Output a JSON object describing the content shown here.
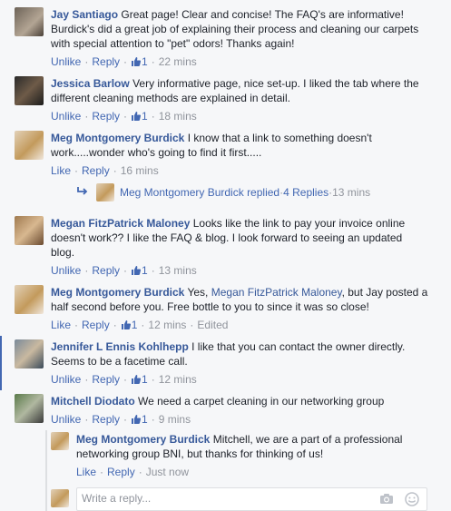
{
  "comments": [
    {
      "name": "Jay Santiago",
      "text": "Great page! Clear and concise! The FAQ's are informative! Burdick's did a great job of explaining their process and cleaning our carpets with special attention to \"pet\" odors! Thanks again!",
      "actions": {
        "like": "Unlike",
        "reply": "Reply",
        "likes": "1",
        "time": "22 mins"
      }
    },
    {
      "name": "Jessica Barlow",
      "text": "Very informative page, nice set-up. I liked the tab where the different cleaning methods are explained in detail.",
      "actions": {
        "like": "Unlike",
        "reply": "Reply",
        "likes": "1",
        "time": "18 mins"
      }
    },
    {
      "name": "Meg Montgomery Burdick",
      "text": "I know that a link to something doesn't work.....wonder who's going to find it first.....",
      "actions": {
        "like": "Like",
        "reply": "Reply",
        "time": "16 mins"
      },
      "replies_summary": {
        "name": "Meg Montgomery Burdick",
        "replied": "replied",
        "count": "4 Replies",
        "time": "13 mins"
      }
    },
    {
      "name": "Megan FitzPatrick Maloney",
      "text": "Looks like the link to pay your invoice online doesn't work?? I like the FAQ & blog. I look forward to seeing an updated blog.",
      "actions": {
        "like": "Unlike",
        "reply": "Reply",
        "likes": "1",
        "time": "13 mins"
      }
    },
    {
      "name": "Meg Montgomery Burdick",
      "text_before": "Yes,",
      "mention": "Megan FitzPatrick Maloney",
      "text_after": ", but Jay posted a half second before you. Free bottle to you to since it was so close!",
      "actions": {
        "like": "Like",
        "reply": "Reply",
        "likes": "1",
        "time": "12 mins",
        "edited": "Edited"
      }
    },
    {
      "name": "Jennifer L Ennis Kohlhepp",
      "text": "I like that you can contact the owner directly. Seems to be a facetime call.",
      "actions": {
        "like": "Unlike",
        "reply": "Reply",
        "likes": "1",
        "time": "12 mins"
      }
    },
    {
      "name": "Mitchell Diodato",
      "text": "We need a carpet cleaning in our networking group",
      "actions": {
        "like": "Unlike",
        "reply": "Reply",
        "likes": "1",
        "time": "9 mins"
      }
    }
  ],
  "reply": {
    "name": "Meg Montgomery Burdick",
    "text": "Mitchell, we are a part of a professional networking group BNI, but thanks for thinking of us!",
    "actions": {
      "like": "Like",
      "reply": "Reply",
      "time": "Just now"
    }
  },
  "reply_box": {
    "placeholder": "Write a reply..."
  },
  "colors": {
    "link": "#365899",
    "meta": "#90949c",
    "action_link": "#4267b2",
    "highlight": "#4267b2"
  }
}
